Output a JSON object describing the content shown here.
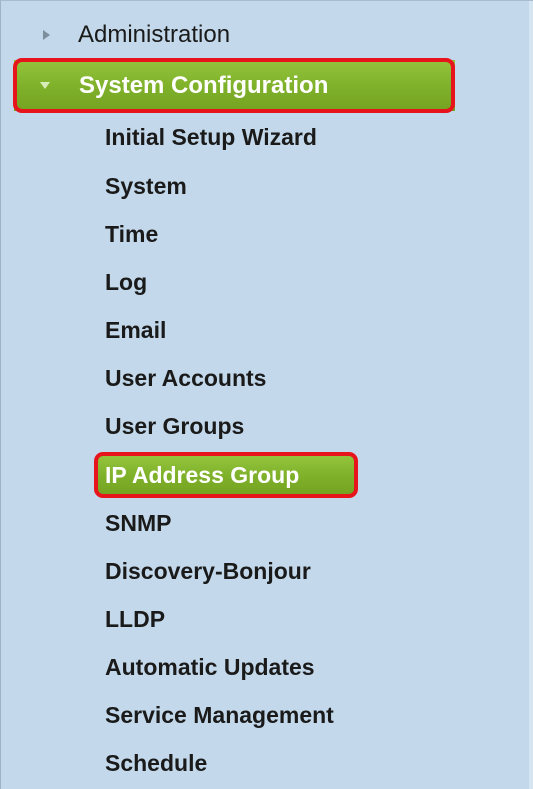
{
  "nav": {
    "administration_label": "Administration",
    "system_configuration_label": "System Configuration",
    "sub_items": [
      "Initial Setup Wizard",
      "System",
      "Time",
      "Log",
      "Email",
      "User Accounts",
      "User Groups",
      "IP Address Group",
      "SNMP",
      "Discovery-Bonjour",
      "LLDP",
      "Automatic Updates",
      "Service Management",
      "Schedule"
    ],
    "selected_item": "IP Address Group"
  },
  "colors": {
    "panel_background": "#c3d9eb",
    "selected_background": "#80b02b",
    "highlight_border": "#e8141c"
  },
  "icons": {
    "collapsed": "caret-right-icon",
    "expanded": "caret-down-icon"
  }
}
